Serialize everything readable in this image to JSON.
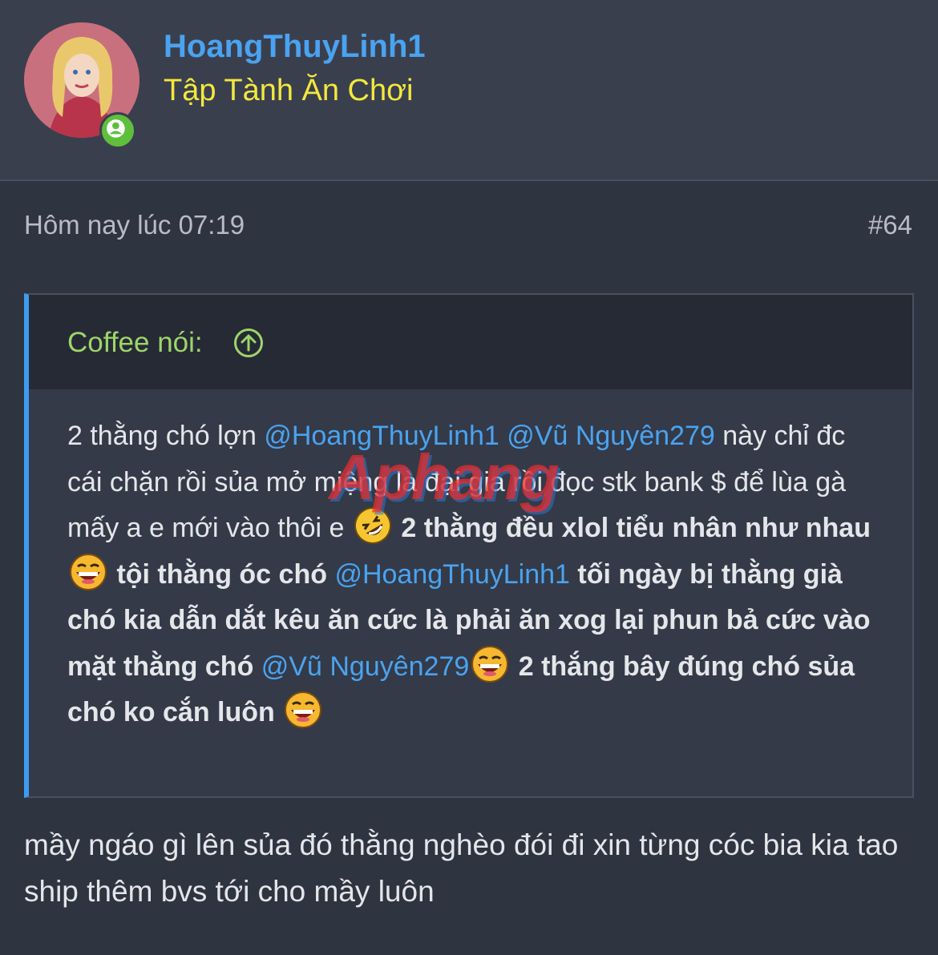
{
  "user": {
    "name": "HoangThuyLinh1",
    "title": "Tập Tành Ăn Chơi",
    "status_icon": "online-user-icon"
  },
  "post": {
    "time": "Hôm nay lúc 07:19",
    "number": "#64"
  },
  "quote": {
    "author_label": "Coffee nói:",
    "arrow_icon": "circle-arrow-up-icon",
    "segments": {
      "s1": "2 thằng chó lợn ",
      "m1": "@HoangThuyLinh1",
      "s2": " ",
      "m2": "@Vũ Nguyên279",
      "s3": " này chỉ đc cái chặn rồi sủa mở miệng là đại gia rồi đọc stk bank $ để lùa gà mấy a e mới vào thôi e ",
      "s4": " 2 thằng đều xlol tiểu nhân như nhau ",
      "s5": " tội thằng óc chó ",
      "m3": "@HoangThuyLinh1",
      "s6": " tối ngày bị thằng già chó kia dẫn dắt kêu ăn cức là phải ăn xog lại phun bả cức vào mặt thằng chó ",
      "m4": "@Vũ Nguyên279",
      "s7": " 2 thắng bây đúng chó sủa chó ko cắn luôn "
    },
    "emoji_icons": [
      "rolling-laugh-emoji-icon",
      "laughing-emoji-icon",
      "laughing-emoji-icon",
      "laughing-emoji-icon"
    ]
  },
  "watermark": "Aphang",
  "reply": "mầy ngáo gì lên sủa đó thằng nghèo đói đi xin từng cóc bia kia tao ship thêm bvs tới cho mầy luôn",
  "colors": {
    "background": "#2f3441",
    "header": "#3a3f4e",
    "link": "#4aa3f0",
    "user_title": "#f2e83d",
    "quote_author": "#9ed56a",
    "quote_border": "#3d9cf0",
    "online": "#5fbf3d"
  }
}
